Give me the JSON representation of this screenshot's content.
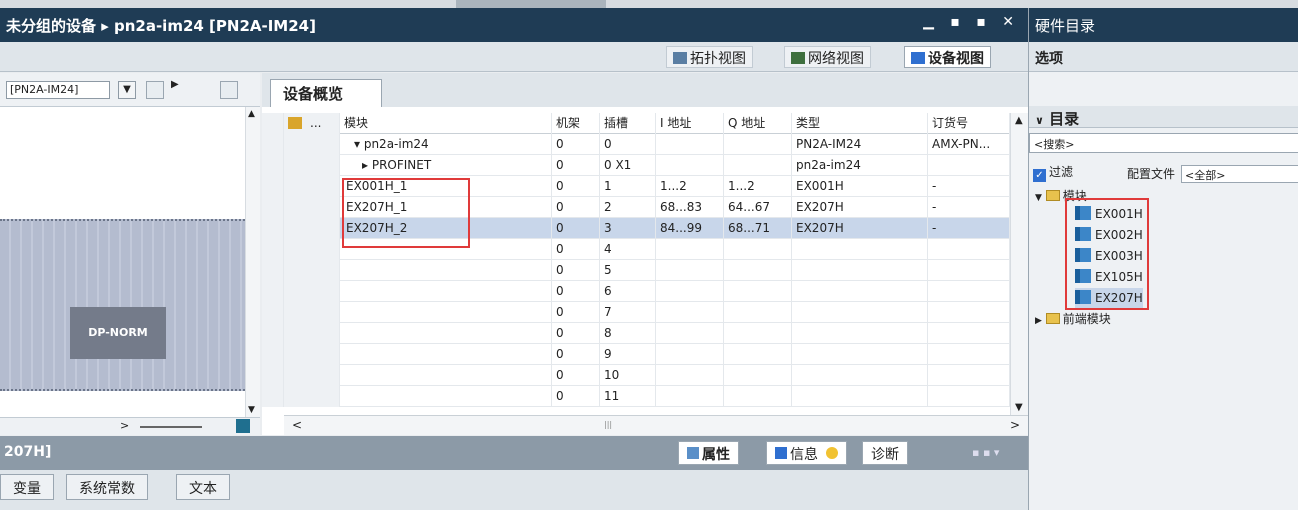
{
  "title_bar": {
    "breadcrumb": "未分组的设备 ▸ pn2a-im24 [PN2A-IM24]",
    "window_buttons": "▁ ▪ ▪ ✕"
  },
  "views": {
    "topology": "拓扑视图",
    "network": "网络视图",
    "device": "设备视图"
  },
  "left_panel": {
    "device_select": "[PN2A-IM24]",
    "module_label": "DP-NORM"
  },
  "overview": {
    "tab": "设备概览",
    "columns": [
      "模块",
      "机架",
      "插槽",
      "I 地址",
      "Q 地址",
      "类型",
      "订货号"
    ],
    "rows": [
      {
        "module": "▾ pn2a-im24",
        "indent": 1,
        "rack": "0",
        "slot": "0",
        "i": "",
        "q": "",
        "type": "PN2A-IM24",
        "order": "AMX-PN..."
      },
      {
        "module": "▸ PROFINET",
        "indent": 2,
        "rack": "0",
        "slot": "0 X1",
        "i": "",
        "q": "",
        "type": "pn2a-im24",
        "order": ""
      },
      {
        "module": "EX001H_1",
        "indent": 0,
        "rack": "0",
        "slot": "1",
        "i": "1...2",
        "q": "1...2",
        "type": "EX001H",
        "order": "-"
      },
      {
        "module": "EX207H_1",
        "indent": 0,
        "rack": "0",
        "slot": "2",
        "i": "68...83",
        "q": "64...67",
        "type": "EX207H",
        "order": "-"
      },
      {
        "module": "EX207H_2",
        "indent": 0,
        "rack": "0",
        "slot": "3",
        "i": "84...99",
        "q": "68...71",
        "type": "EX207H",
        "order": "-"
      },
      {
        "module": "",
        "indent": 0,
        "rack": "0",
        "slot": "4",
        "i": "",
        "q": "",
        "type": "",
        "order": ""
      },
      {
        "module": "",
        "indent": 0,
        "rack": "0",
        "slot": "5",
        "i": "",
        "q": "",
        "type": "",
        "order": ""
      },
      {
        "module": "",
        "indent": 0,
        "rack": "0",
        "slot": "6",
        "i": "",
        "q": "",
        "type": "",
        "order": ""
      },
      {
        "module": "",
        "indent": 0,
        "rack": "0",
        "slot": "7",
        "i": "",
        "q": "",
        "type": "",
        "order": ""
      },
      {
        "module": "",
        "indent": 0,
        "rack": "0",
        "slot": "8",
        "i": "",
        "q": "",
        "type": "",
        "order": ""
      },
      {
        "module": "",
        "indent": 0,
        "rack": "0",
        "slot": "9",
        "i": "",
        "q": "",
        "type": "",
        "order": ""
      },
      {
        "module": "",
        "indent": 0,
        "rack": "0",
        "slot": "10",
        "i": "",
        "q": "",
        "type": "",
        "order": ""
      },
      {
        "module": "",
        "indent": 0,
        "rack": "0",
        "slot": "11",
        "i": "",
        "q": "",
        "type": "",
        "order": ""
      }
    ],
    "selected_row": 4
  },
  "inspector": {
    "title": "207H]",
    "tabs": {
      "properties": "属性",
      "info": "信息",
      "diagnostics": "诊断"
    },
    "sub_tabs": [
      "变量",
      "系统常数",
      "文本"
    ]
  },
  "catalog": {
    "title": "硬件目录",
    "options": "选项",
    "section": "目录",
    "search_placeholder": "<搜索>",
    "filter_label": "过滤",
    "profile_label": "配置文件",
    "profile_value": "<全部>",
    "modules_folder": "模块",
    "modules": [
      "EX001H",
      "EX002H",
      "EX003H",
      "EX105H",
      "EX207H"
    ],
    "frontend_folder": "前端模块"
  },
  "colors": {
    "title_bar": "#1f3c55",
    "selection": "#c8d6ea",
    "highlight_box": "#e03a3a"
  }
}
